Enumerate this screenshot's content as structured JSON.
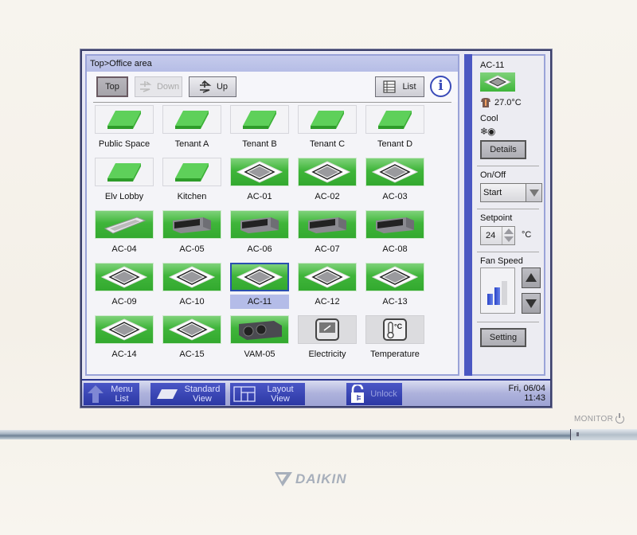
{
  "device": {
    "brand": "DAIKIN",
    "monitor_label": "MONITOR"
  },
  "main": {
    "breadcrumb": "Top>Office area",
    "toolbar": {
      "top_label": "Top",
      "down_label": "Down",
      "up_label": "Up",
      "list_label": "List",
      "info_label": "i"
    },
    "tiles": [
      {
        "label": "Public Space",
        "type": "area",
        "status": "green"
      },
      {
        "label": "Tenant A",
        "type": "area",
        "status": "green"
      },
      {
        "label": "Tenant B",
        "type": "area",
        "status": "green"
      },
      {
        "label": "Tenant C",
        "type": "area",
        "status": "green"
      },
      {
        "label": "Tenant D",
        "type": "area",
        "status": "green"
      },
      {
        "label": "Elv Lobby",
        "type": "area",
        "status": "green"
      },
      {
        "label": "Kitchen",
        "type": "area",
        "status": "green"
      },
      {
        "label": "AC-01",
        "type": "cassette",
        "status": "green"
      },
      {
        "label": "AC-02",
        "type": "cassette",
        "status": "green"
      },
      {
        "label": "AC-03",
        "type": "cassette",
        "status": "green"
      },
      {
        "label": "AC-04",
        "type": "ceiling",
        "status": "green"
      },
      {
        "label": "AC-05",
        "type": "duct",
        "status": "green"
      },
      {
        "label": "AC-06",
        "type": "duct",
        "status": "green"
      },
      {
        "label": "AC-07",
        "type": "duct",
        "status": "green"
      },
      {
        "label": "AC-08",
        "type": "duct",
        "status": "green"
      },
      {
        "label": "AC-09",
        "type": "cassette",
        "status": "green"
      },
      {
        "label": "AC-10",
        "type": "cassette",
        "status": "green"
      },
      {
        "label": "AC-11",
        "type": "cassette",
        "status": "green",
        "selected": true
      },
      {
        "label": "AC-12",
        "type": "cassette",
        "status": "green"
      },
      {
        "label": "AC-13",
        "type": "cassette",
        "status": "green"
      },
      {
        "label": "AC-14",
        "type": "cassette",
        "status": "green"
      },
      {
        "label": "AC-15",
        "type": "cassette",
        "status": "green"
      },
      {
        "label": "VAM-05",
        "type": "vam",
        "status": "green"
      },
      {
        "label": "Electricity",
        "type": "electricity",
        "status": "gray"
      },
      {
        "label": "Temperature",
        "type": "temperature",
        "status": "gray"
      }
    ]
  },
  "side": {
    "unit_name": "AC-11",
    "room_temp": "27.0°C",
    "mode": "Cool",
    "mode_icon": "❄◉",
    "details_label": "Details",
    "onoff_label": "On/Off",
    "onoff_value": "Start",
    "setpoint_label": "Setpoint",
    "setpoint_value": "24",
    "setpoint_unit": "°C",
    "fan_label": "Fan Speed",
    "fan_level": 2,
    "fan_levels_total": 3,
    "setting_label": "Setting"
  },
  "bottom": {
    "menu_list": "Menu\nList",
    "standard_view": "Standard\nView",
    "layout_view": "Layout\nView",
    "unlock": "Unlock",
    "date": "Fri, 06/04",
    "time": "11:43"
  }
}
